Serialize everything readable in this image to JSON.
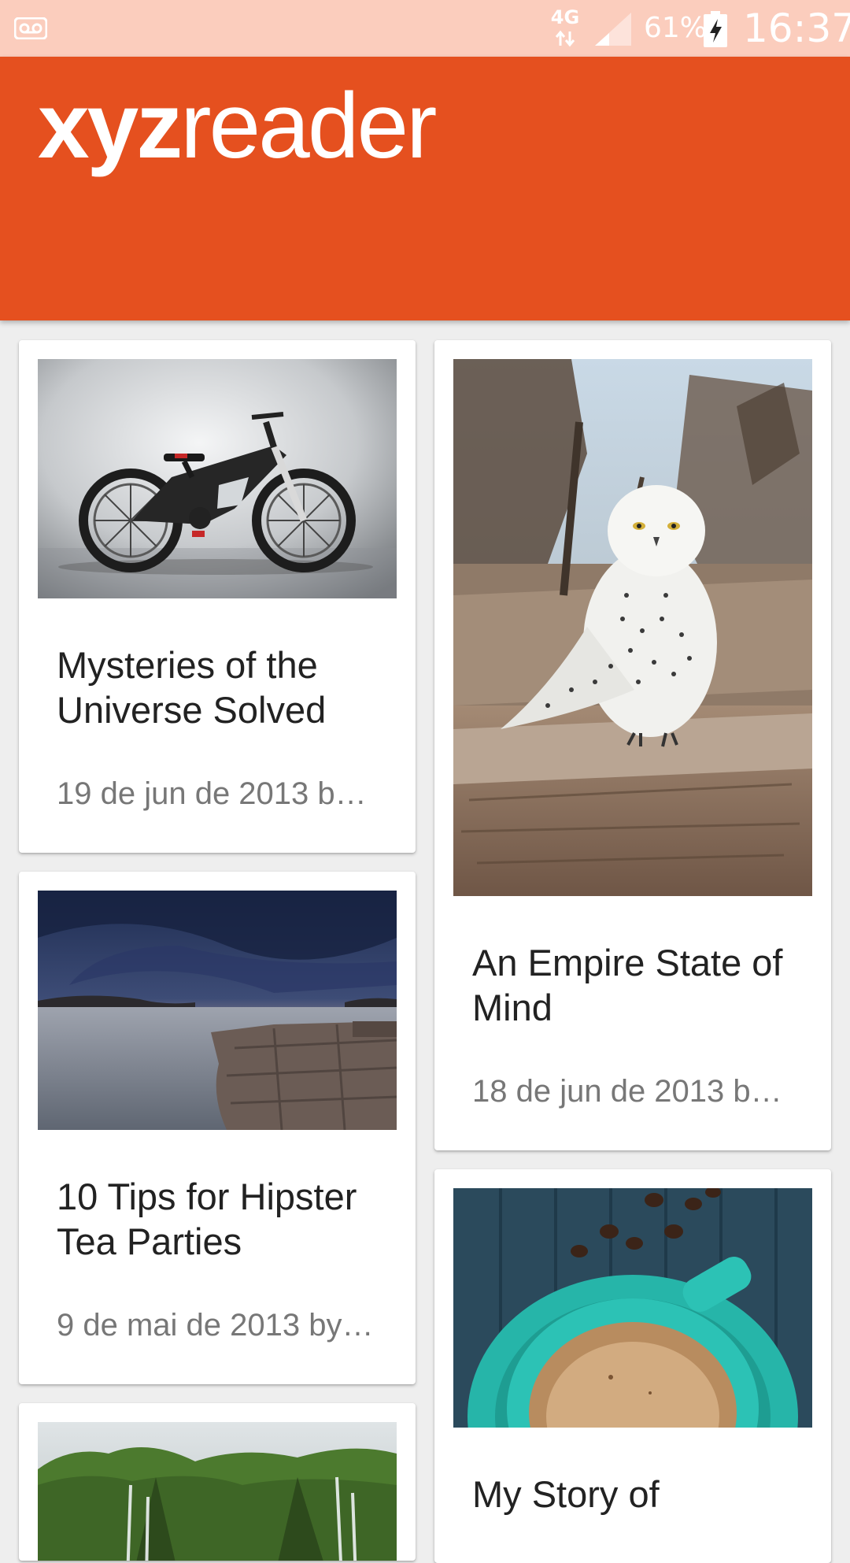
{
  "status_bar": {
    "network": "4G",
    "battery_percent": "61%",
    "time": "16:37",
    "icons": [
      "voicemail-icon",
      "network-4g-icon",
      "signal-icon",
      "battery-charging-icon"
    ]
  },
  "app_bar": {
    "logo_bold": "xyz",
    "logo_light": "reader",
    "background_color": "#e5501f"
  },
  "articles": [
    {
      "title": "Mysteries of the Universe Solved",
      "subtitle": "19 de jun de 2013 b…",
      "image": "bicycle-photo"
    },
    {
      "title": "An Empire State of Mind",
      "subtitle": "18 de jun de 2013 b…",
      "image": "snowy-owl-photo"
    },
    {
      "title": "10 Tips for Hipster Tea Parties",
      "subtitle": "9 de mai de 2013 by…",
      "image": "seascape-photo"
    },
    {
      "title": "My Story of",
      "subtitle": "",
      "image": "coffee-cup-photo"
    },
    {
      "title": "",
      "subtitle": "",
      "image": "waterfall-cliffs-photo"
    }
  ]
}
